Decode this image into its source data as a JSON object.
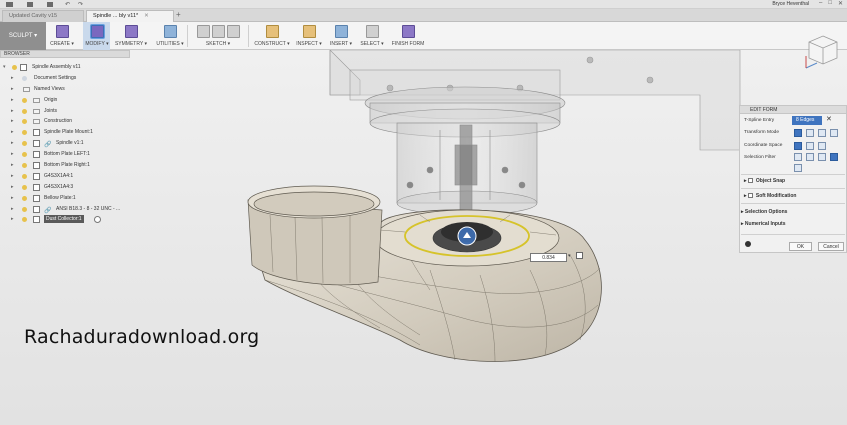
{
  "window": {
    "user_name": "Bryce Heventhal",
    "help_icon": "help-icon",
    "controls": [
      "–",
      "□",
      "✕"
    ]
  },
  "tabs": [
    {
      "label": "Updated Cavity v15",
      "active": false
    },
    {
      "label": "Spindle ... bly v11*",
      "active": true
    }
  ],
  "toolbar": {
    "workspace_label": "SCULPT ▾",
    "groups": [
      {
        "label": "CREATE ▾"
      },
      {
        "label": "MODIFY ▾"
      },
      {
        "label": "SYMMETRY ▾"
      },
      {
        "label": "UTILITIES ▾"
      },
      {
        "label": "SKETCH ▾"
      },
      {
        "label": "CONSTRUCT ▾"
      },
      {
        "label": "INSPECT ▾"
      },
      {
        "label": "INSERT ▾"
      },
      {
        "label": "SELECT ▾"
      },
      {
        "label": "FINISH FORM"
      }
    ]
  },
  "browser": {
    "title": "BROWSER",
    "items": [
      {
        "label": "Spindle Assembly v11",
        "level": 0
      },
      {
        "label": "Document Settings",
        "level": 1
      },
      {
        "label": "Named Views",
        "level": 1
      },
      {
        "label": "Origin",
        "level": 1
      },
      {
        "label": "Joints",
        "level": 1
      },
      {
        "label": "Construction",
        "level": 1
      },
      {
        "label": "Spindle Plate Mount:1",
        "level": 1
      },
      {
        "label": "Spindle v1:1",
        "level": 1
      },
      {
        "label": "Bottom Plate LEFT:1",
        "level": 1
      },
      {
        "label": "Bottom Plate Right:1",
        "level": 1
      },
      {
        "label": "G4S3X1A4:1",
        "level": 1
      },
      {
        "label": "G4S3X1A4:3",
        "level": 1
      },
      {
        "label": "Bellow Plate:1",
        "level": 1
      },
      {
        "label": "ANSI B18.3 - 8 - 32 UNC - ...",
        "level": 1
      },
      {
        "label": "Dust Collector:1",
        "level": 1,
        "highlighted": true
      }
    ]
  },
  "edit_form": {
    "title": "EDIT FORM",
    "t_spline_entry_label": "T-Spline Entry",
    "selection_chip": "8 Edges",
    "transform_mode_label": "Transform Mode",
    "coordinate_space_label": "Coordinate Space",
    "selection_filter_label": "Selection Filter",
    "object_snap_label": "Object Snap",
    "soft_modification_label": "Soft Modification",
    "selection_options_label": "Selection Options",
    "numerical_inputs_label": "Numerical Inputs",
    "ok_label": "OK",
    "cancel_label": "Cancel"
  },
  "value_input": {
    "value": "0.834"
  },
  "watermark": "Rachaduradownload.org",
  "colors": {
    "sculpt_bg": "#8f8f8f",
    "selected_blue": "#3f74bf",
    "selection_yellow": "#d6c32a",
    "surface": "#d8d2c5"
  }
}
